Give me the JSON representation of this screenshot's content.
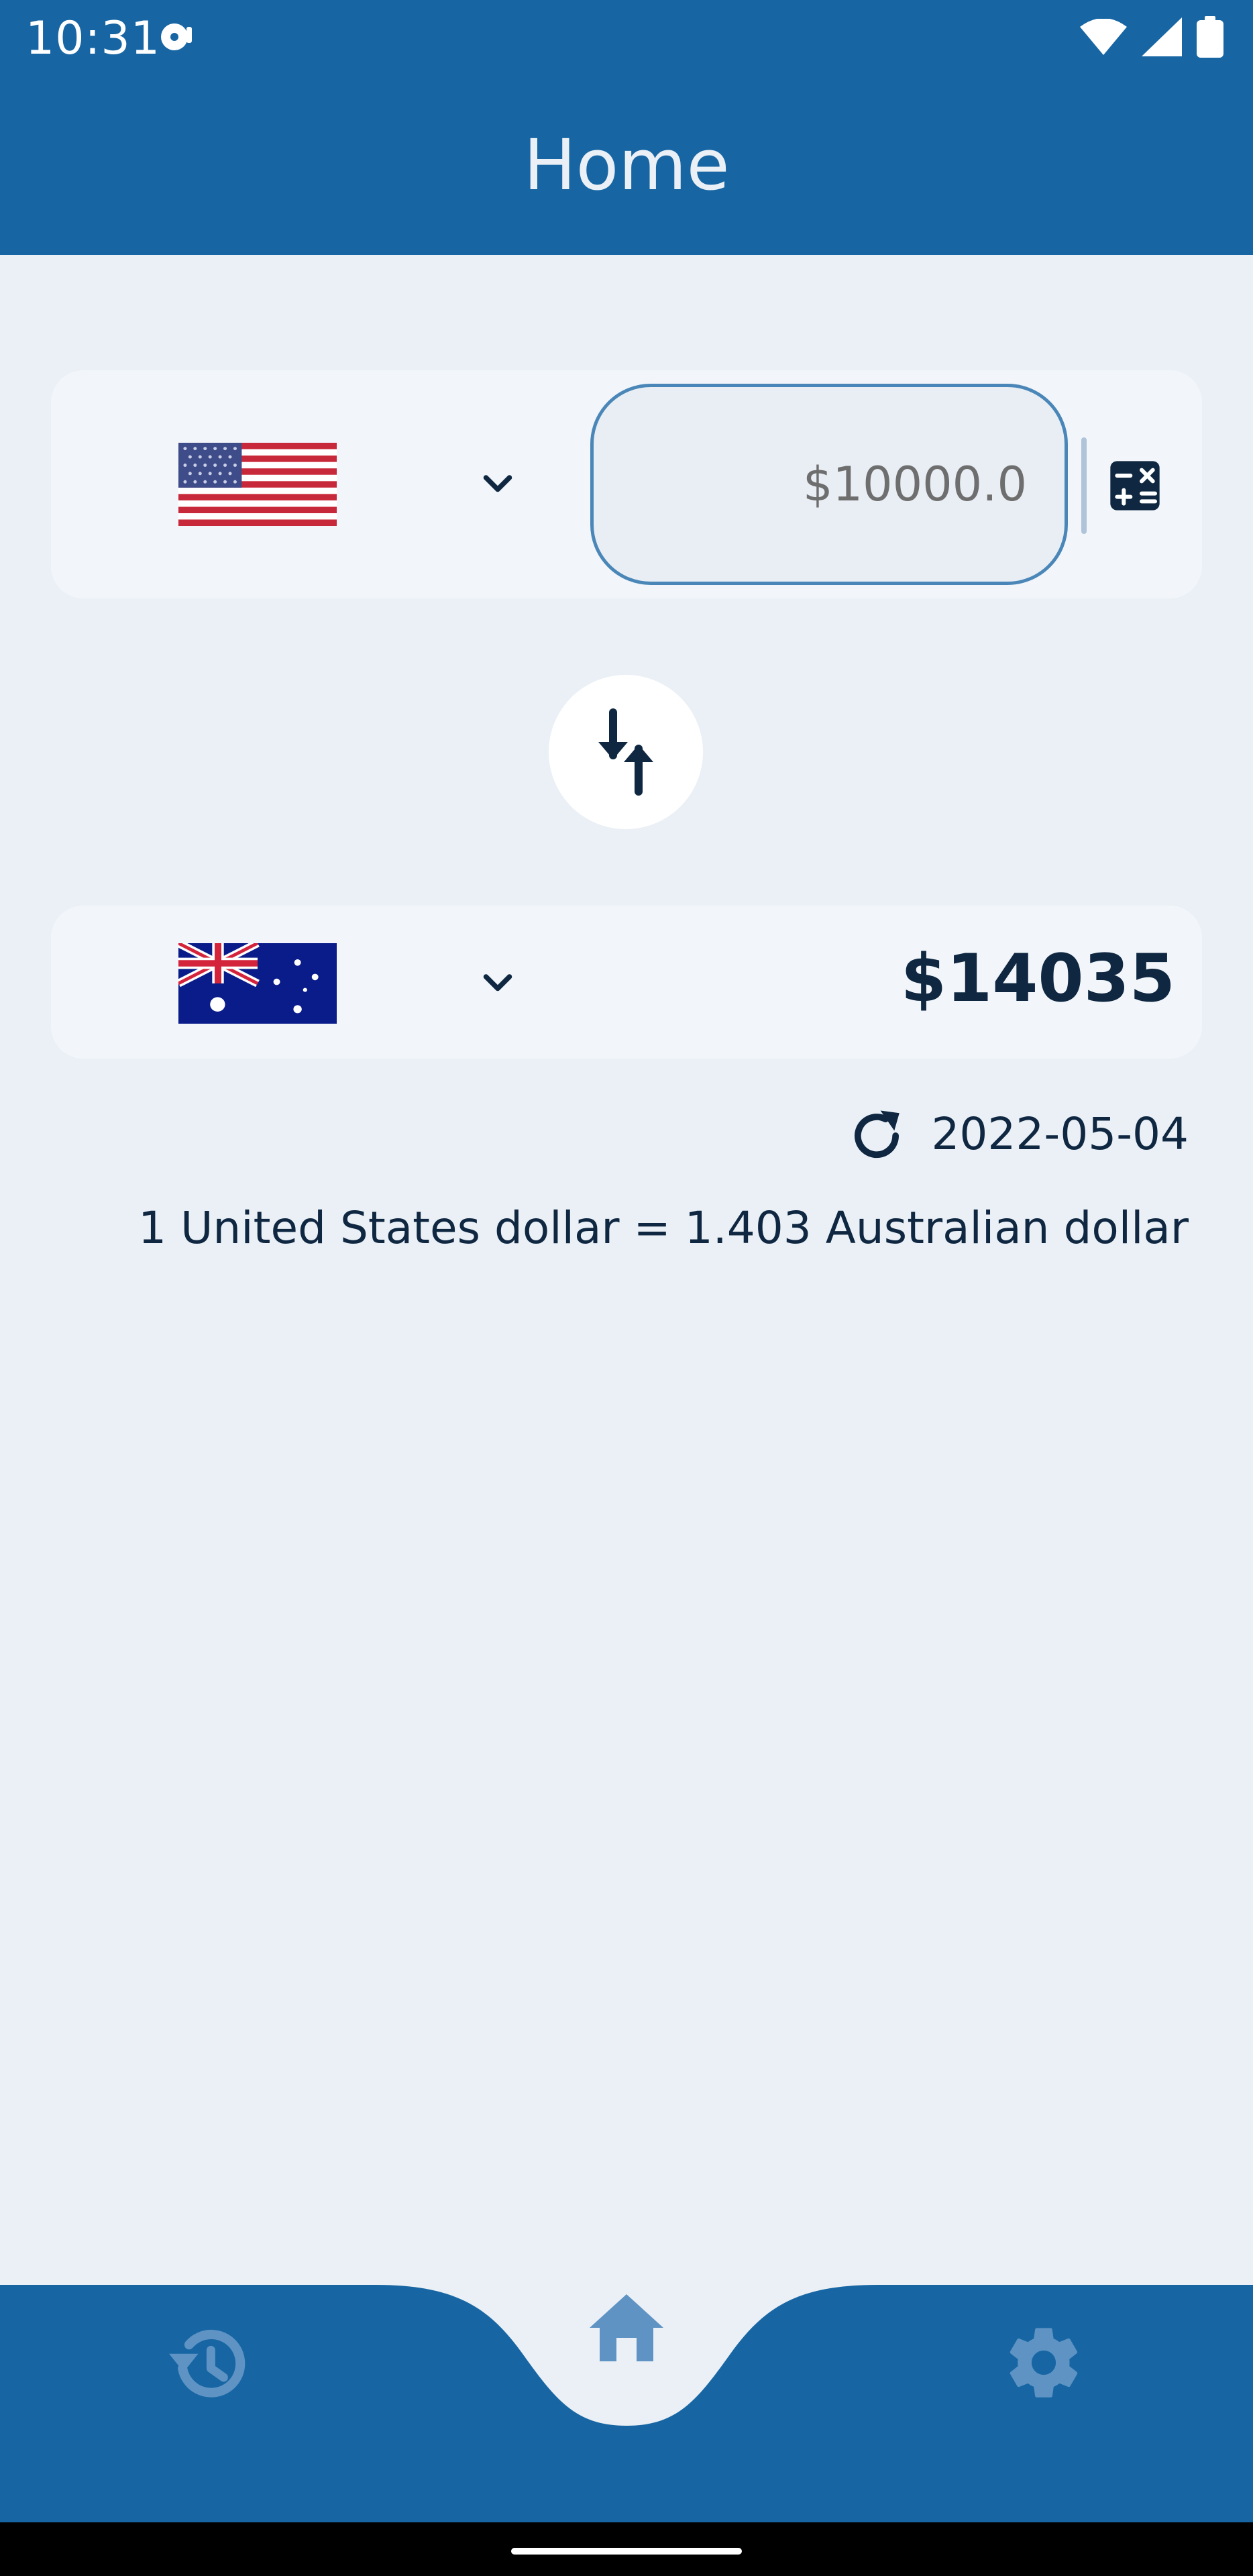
{
  "status_bar": {
    "time": "10:31",
    "icons": [
      "media-disc-icon",
      "wifi-icon",
      "signal-icon",
      "battery-icon"
    ]
  },
  "header": {
    "title": "Home"
  },
  "from_currency": {
    "flag": "us-flag",
    "amount_placeholder": "$10000.0",
    "calculator_icon": "calculator-icon"
  },
  "swap": {
    "icon": "swap-arrows-icon"
  },
  "to_currency": {
    "flag": "au-flag",
    "amount": "$14035"
  },
  "rate": {
    "date": "2022-05-04",
    "description": "1 United States dollar = 1.403 Australian dollar",
    "refresh_icon": "refresh-icon"
  },
  "bottom_nav": {
    "items": [
      {
        "icon": "history-icon",
        "active": false
      },
      {
        "icon": "home-icon",
        "active": true
      },
      {
        "icon": "gear-icon",
        "active": false
      }
    ]
  },
  "colors": {
    "primary": "#1766A3",
    "background": "#EAF0F6",
    "card": "#F2F6FA",
    "text_dark": "#0F2741",
    "nav_icon": "#5E93C4"
  }
}
